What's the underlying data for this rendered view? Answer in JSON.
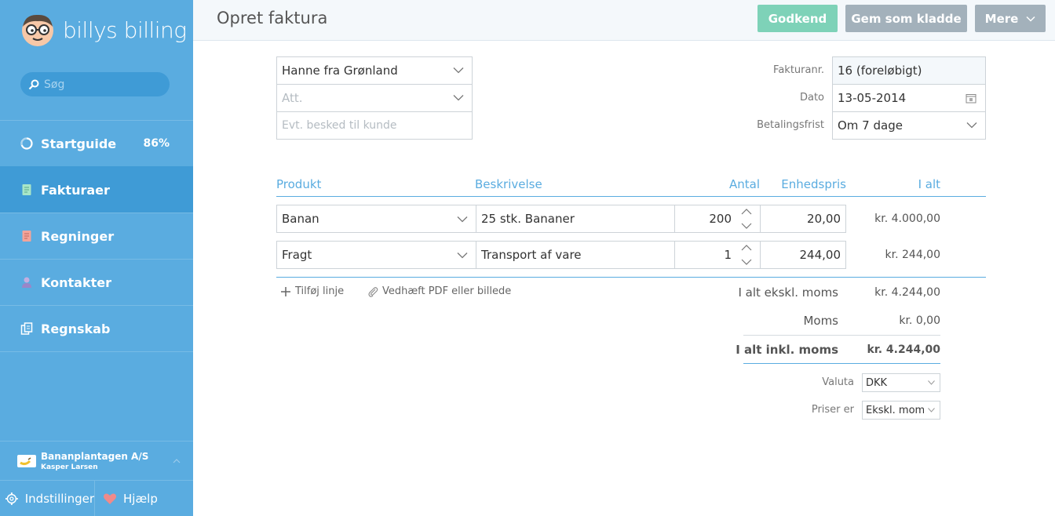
{
  "brand": {
    "name": "billys billing"
  },
  "search": {
    "placeholder": "Søg"
  },
  "nav": {
    "items": [
      {
        "label": "Startguide",
        "badge": "86%"
      },
      {
        "label": "Fakturaer",
        "active": true
      },
      {
        "label": "Regninger"
      },
      {
        "label": "Kontakter"
      },
      {
        "label": "Regnskab"
      }
    ]
  },
  "company": {
    "name": "Bananplantagen A/S",
    "user": "Kasper Larsen"
  },
  "footer": {
    "settings_label": "Indstillinger",
    "help_label": "Hjælp"
  },
  "header": {
    "title": "Opret faktura",
    "approve_label": "Godkend",
    "draft_label": "Gem som kladde",
    "more_label": "Mere"
  },
  "customer": {
    "name": "Hanne fra Grønland",
    "att_placeholder": "Att.",
    "message_placeholder": "Evt. besked til kunde"
  },
  "meta": {
    "invoice_no_label": "Fakturanr.",
    "invoice_no": "16 (foreløbigt)",
    "date_label": "Dato",
    "date": "13-05-2014",
    "due_label": "Betalingsfrist",
    "due": "Om 7 dage"
  },
  "table": {
    "headers": {
      "product": "Produkt",
      "description": "Beskrivelse",
      "qty": "Antal",
      "unit_price": "Enhedspris",
      "total": "I alt"
    },
    "rows": [
      {
        "product": "Banan",
        "description": "25 stk. Bananer",
        "qty": "200",
        "unit_price": "20,00",
        "total": "kr. 4.000,00"
      },
      {
        "product": "Fragt",
        "description": "Transport af vare",
        "qty": "1",
        "unit_price": "244,00",
        "total": "kr. 244,00"
      }
    ]
  },
  "actions": {
    "add_line": "Tilføj linje",
    "attach": "Vedhæft PDF eller billede"
  },
  "totals": {
    "excl_label": "I alt ekskl. moms",
    "excl_value": "kr. 4.244,00",
    "vat_label": "Moms",
    "vat_value": "kr. 0,00",
    "incl_label": "I alt inkl. moms",
    "incl_value": "kr. 4.244,00"
  },
  "options": {
    "currency_label": "Valuta",
    "currency": "DKK",
    "prices_label": "Priser er",
    "prices": "Ekskl. moms"
  },
  "colors": {
    "sidebar": "#5aace0",
    "active": "#3f9bd6",
    "approve": "#7ed2b8",
    "secondary": "#a3b1bb"
  }
}
